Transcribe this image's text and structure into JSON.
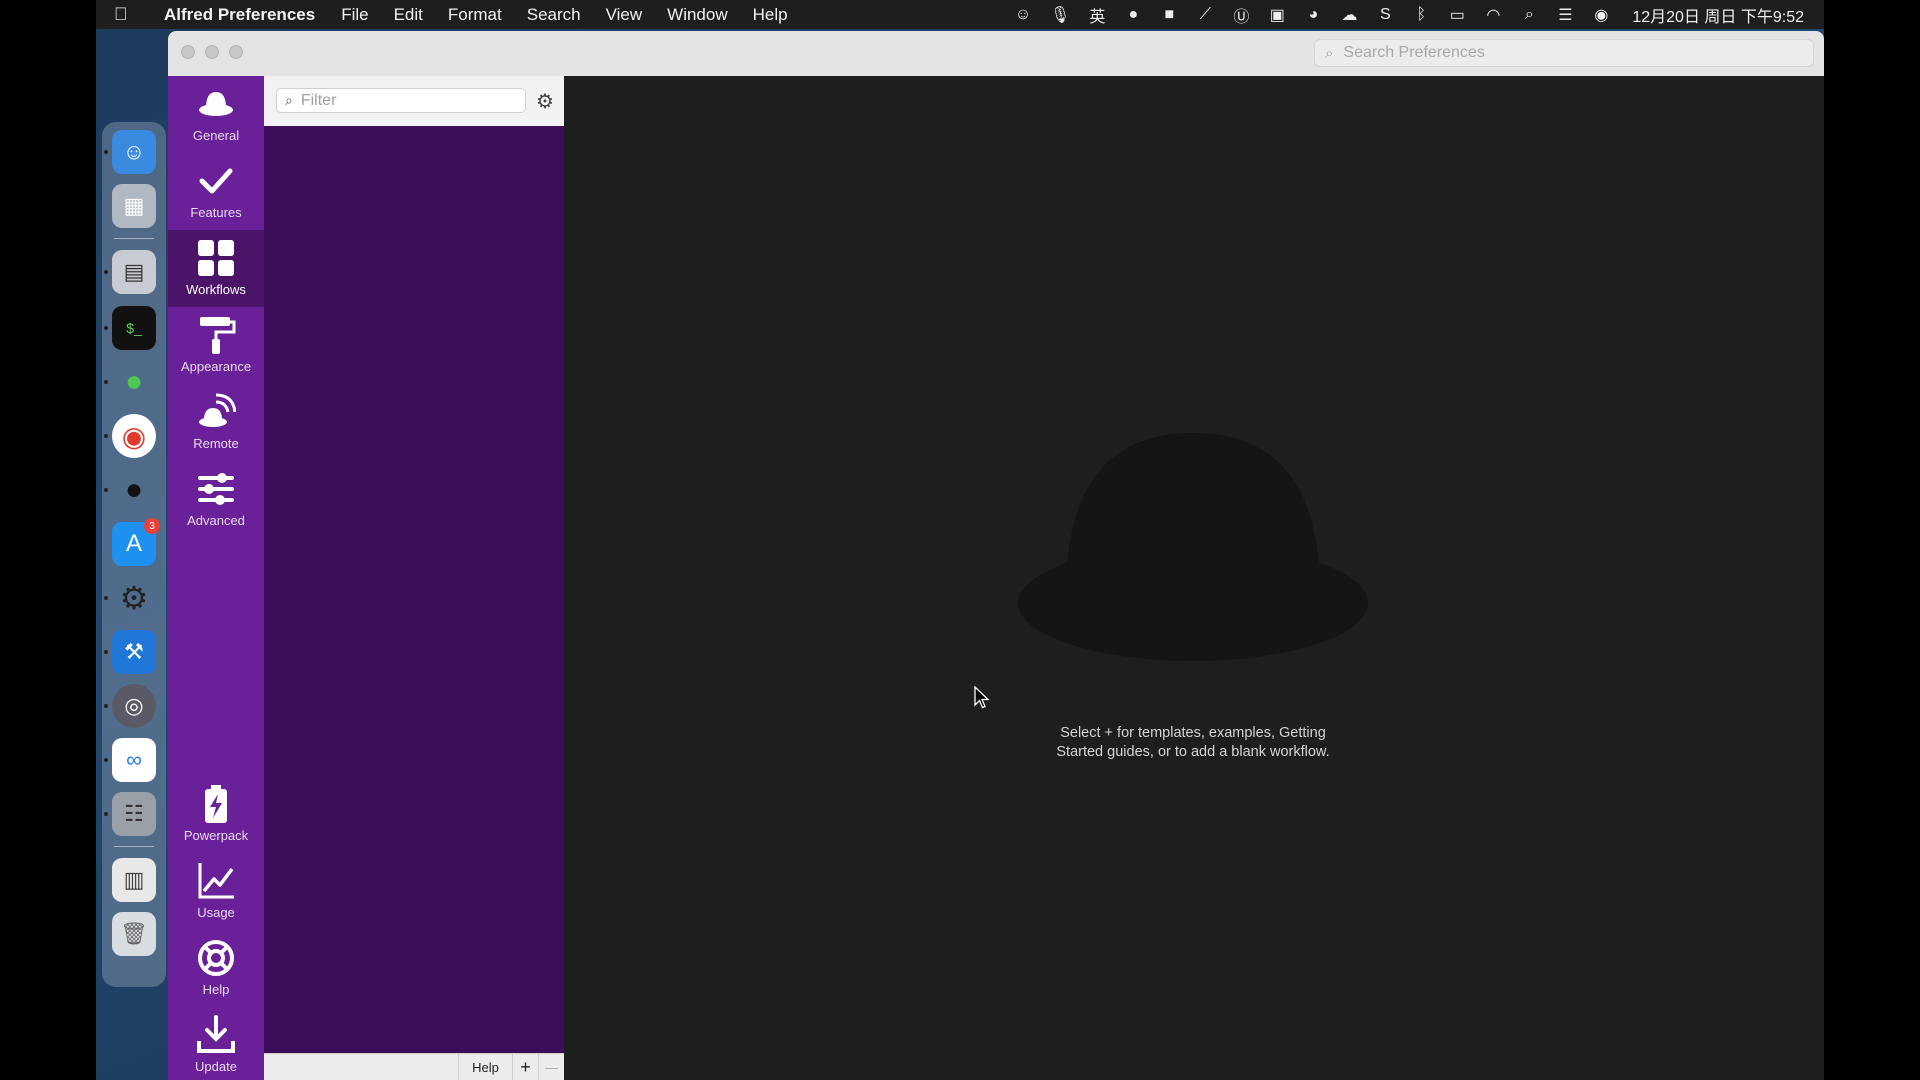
{
  "menubar": {
    "app_name": "Alfred Preferences",
    "menus": [
      "File",
      "Edit",
      "Format",
      "Search",
      "View",
      "Window",
      "Help"
    ],
    "input_method": "英",
    "clock": "12月20日 周日 下午9:52"
  },
  "dock": {
    "appstore_badge": "3"
  },
  "window": {
    "search_placeholder": "Search Preferences"
  },
  "nav": {
    "items": [
      {
        "label": "General",
        "icon": "hat-icon"
      },
      {
        "label": "Features",
        "icon": "checkmark-icon"
      },
      {
        "label": "Workflows",
        "icon": "grid-icon"
      },
      {
        "label": "Appearance",
        "icon": "paint-roller-icon"
      },
      {
        "label": "Remote",
        "icon": "remote-icon"
      },
      {
        "label": "Advanced",
        "icon": "sliders-icon"
      },
      {
        "label": "Powerpack",
        "icon": "battery-icon"
      },
      {
        "label": "Usage",
        "icon": "chart-icon"
      },
      {
        "label": "Help",
        "icon": "lifebuoy-icon"
      },
      {
        "label": "Update",
        "icon": "download-icon"
      }
    ],
    "active": "Workflows"
  },
  "workflows": {
    "filter_placeholder": "Filter",
    "help_label": "Help",
    "add_label": "+",
    "remove_label": "—",
    "empty_message_line1": "Select + for templates, examples, Getting",
    "empty_message_line2": "Started guides, or to add a blank workflow."
  },
  "colors": {
    "nav_bg": "#6a2098",
    "nav_active": "#4b1469",
    "list_bg": "#3c0d58",
    "main_bg": "#1e1e1e"
  }
}
